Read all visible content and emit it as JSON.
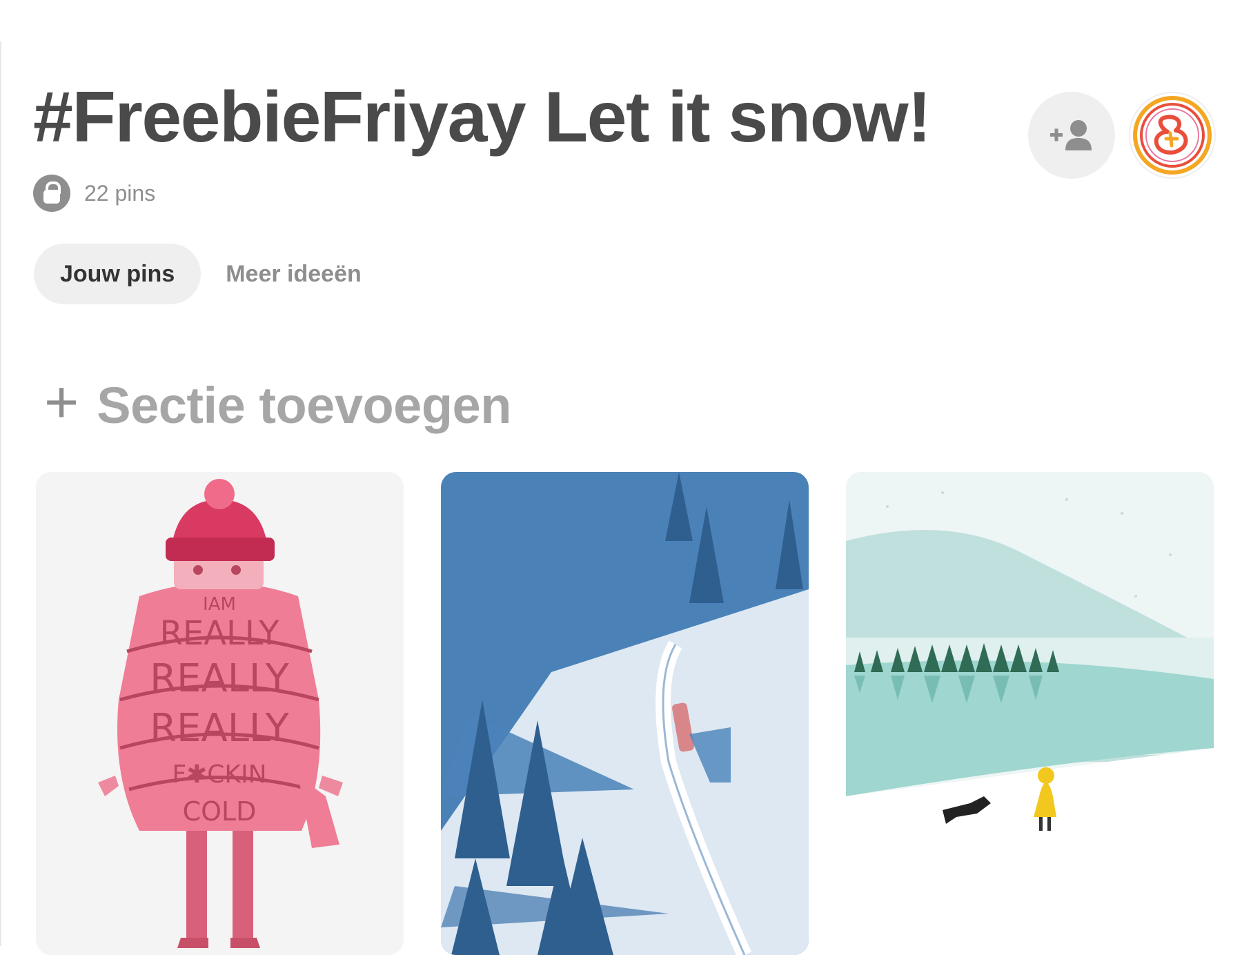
{
  "board": {
    "title": "#FreebieFriyay Let it snow!",
    "pin_count": "22 pins",
    "visibility_icon": "lock-icon"
  },
  "header_actions": {
    "collaborator_icon": "add-person-icon",
    "avatar_icon": "profile-logo"
  },
  "tabs": [
    {
      "label": "Jouw pins",
      "active": true
    },
    {
      "label": "Meer ideeën",
      "active": false
    }
  ],
  "add_section": {
    "plus": "+",
    "label": "Sectie toevoegen"
  },
  "pins": [
    {
      "name": "pin-really-cold-illustration",
      "scarf_text": [
        "IAM",
        "REALLY",
        "REALLY",
        "REALLY",
        "F✱CKIN",
        "COLD"
      ]
    },
    {
      "name": "pin-snowy-train-illustration"
    },
    {
      "name": "pin-snowy-lake-illustration"
    }
  ],
  "colors": {
    "title": "#4a4a4a",
    "muted": "#8e8e8e",
    "tab_active_bg": "#efefef",
    "pink": "#e8677f",
    "blue": "#4a82b8"
  }
}
